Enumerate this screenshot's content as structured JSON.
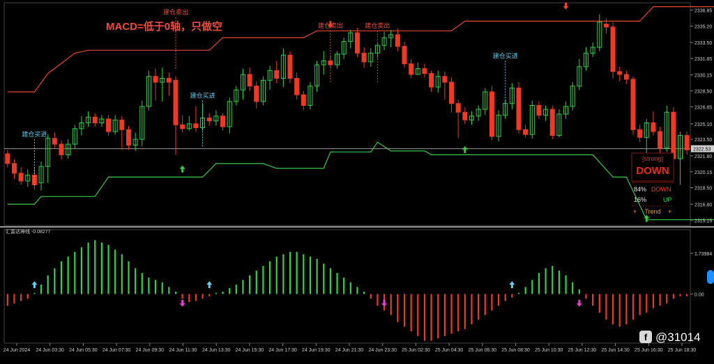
{
  "watermark": "@31014",
  "chart_data": [
    {
      "type": "candlestick",
      "annotation_macd": "MACD=低于0轴，只做空",
      "last_price": "2322.53",
      "y_ticks": [
        "2336.85",
        "2335.20",
        "2333.50",
        "2331.85",
        "2330.15",
        "2328.50",
        "2326.85",
        "2325.10",
        "2323.50",
        "2321.80",
        "2320.15",
        "2318.50",
        "2316.80",
        "2315.15"
      ],
      "ylim": [
        2314.6,
        2337.6
      ],
      "candles": [
        [
          2322.0,
          2321.0,
          2322.4,
          2320.6
        ],
        [
          2321.0,
          2320.0,
          2321.4,
          2319.4
        ],
        [
          2320.0,
          2319.2,
          2320.6,
          2318.8
        ],
        [
          2319.2,
          2319.8,
          2320.4,
          2318.6
        ],
        [
          2319.8,
          2318.8,
          2320.6,
          2318.3
        ],
        [
          2319.0,
          2320.7,
          2321.2,
          2318.2
        ],
        [
          2320.7,
          2323.6,
          2324.0,
          2319.0
        ],
        [
          2323.6,
          2323.0,
          2324.2,
          2322.6
        ],
        [
          2323.0,
          2321.9,
          2323.4,
          2321.4
        ],
        [
          2321.9,
          2323.0,
          2323.5,
          2321.5
        ],
        [
          2323.0,
          2324.6,
          2325.0,
          2322.5
        ],
        [
          2324.6,
          2325.2,
          2325.9,
          2323.9
        ],
        [
          2325.2,
          2325.8,
          2326.4,
          2324.8
        ],
        [
          2325.8,
          2325.2,
          2326.2,
          2324.8
        ],
        [
          2325.2,
          2325.6,
          2326.0,
          2324.8
        ],
        [
          2325.6,
          2324.3,
          2326.0,
          2323.9
        ],
        [
          2324.3,
          2325.5,
          2326.0,
          2324.0
        ],
        [
          2325.5,
          2324.5,
          2325.9,
          2322.4
        ],
        [
          2324.5,
          2322.9,
          2324.9,
          2322.4
        ],
        [
          2322.9,
          2323.5,
          2324.2,
          2322.3
        ],
        [
          2323.5,
          2326.9,
          2327.5,
          2322.8
        ],
        [
          2326.9,
          2330.0,
          2330.6,
          2326.5
        ],
        [
          2330.0,
          2329.4,
          2330.8,
          2327.5
        ],
        [
          2329.4,
          2329.8,
          2330.9,
          2327.4
        ],
        [
          2329.8,
          2329.4,
          2330.4,
          2328.0
        ],
        [
          2329.6,
          2325.0,
          2330.0,
          2321.9
        ],
        [
          2325.0,
          2324.6,
          2326.0,
          2324.2
        ],
        [
          2324.6,
          2325.1,
          2325.9,
          2324.4
        ],
        [
          2325.1,
          2324.7,
          2326.9,
          2324.3
        ],
        [
          2324.7,
          2325.7,
          2327.2,
          2324.4
        ],
        [
          2325.7,
          2325.4,
          2326.2,
          2324.9
        ],
        [
          2325.4,
          2325.9,
          2326.5,
          2324.9
        ],
        [
          2325.9,
          2324.8,
          2326.2,
          2324.4
        ],
        [
          2324.8,
          2327.4,
          2327.8,
          2324.1
        ],
        [
          2327.4,
          2328.6,
          2329.0,
          2327.0
        ],
        [
          2328.6,
          2330.2,
          2330.8,
          2327.6
        ],
        [
          2330.2,
          2329.0,
          2330.9,
          2328.5
        ],
        [
          2329.0,
          2327.4,
          2329.5,
          2326.7
        ],
        [
          2327.4,
          2329.6,
          2330.0,
          2327.0
        ],
        [
          2329.6,
          2330.6,
          2331.1,
          2328.6
        ],
        [
          2330.6,
          2329.8,
          2331.6,
          2329.3
        ],
        [
          2329.8,
          2332.2,
          2332.9,
          2328.9
        ],
        [
          2332.2,
          2329.8,
          2332.6,
          2329.3
        ],
        [
          2329.8,
          2328.1,
          2330.4,
          2327.6
        ],
        [
          2328.1,
          2327.0,
          2328.5,
          2326.5
        ],
        [
          2327.0,
          2329.0,
          2329.4,
          2326.6
        ],
        [
          2329.0,
          2331.2,
          2331.6,
          2328.4
        ],
        [
          2331.2,
          2331.6,
          2332.6,
          2330.2
        ],
        [
          2331.6,
          2331.2,
          2332.2,
          2330.8
        ],
        [
          2331.2,
          2332.3,
          2332.6,
          2330.8
        ],
        [
          2332.3,
          2333.6,
          2334.0,
          2331.8
        ],
        [
          2333.6,
          2334.5,
          2334.8,
          2332.9
        ],
        [
          2334.5,
          2332.4,
          2335.0,
          2332.0
        ],
        [
          2332.4,
          2331.5,
          2333.0,
          2330.9
        ],
        [
          2331.5,
          2332.4,
          2332.9,
          2331.0
        ],
        [
          2332.4,
          2333.2,
          2333.5,
          2331.9
        ],
        [
          2333.2,
          2334.0,
          2334.6,
          2332.7
        ],
        [
          2334.0,
          2334.3,
          2334.8,
          2333.0
        ],
        [
          2334.3,
          2333.1,
          2334.9,
          2332.6
        ],
        [
          2333.1,
          2331.3,
          2333.6,
          2330.9
        ],
        [
          2331.3,
          2330.2,
          2331.8,
          2329.8
        ],
        [
          2330.2,
          2330.8,
          2331.4,
          2330.2
        ],
        [
          2330.8,
          2330.3,
          2331.3,
          2329.9
        ],
        [
          2330.3,
          2328.9,
          2330.6,
          2328.4
        ],
        [
          2328.9,
          2330.0,
          2330.6,
          2328.3
        ],
        [
          2330.0,
          2329.4,
          2330.5,
          2327.6
        ],
        [
          2329.4,
          2327.2,
          2329.9,
          2326.3
        ],
        [
          2327.2,
          2326.3,
          2327.6,
          2323.6
        ],
        [
          2326.3,
          2325.5,
          2326.8,
          2325.1
        ],
        [
          2325.5,
          2325.9,
          2326.4,
          2325.0
        ],
        [
          2325.9,
          2326.6,
          2327.0,
          2325.4
        ],
        [
          2326.6,
          2328.4,
          2328.8,
          2326.0
        ],
        [
          2328.4,
          2323.8,
          2329.0,
          2323.4
        ],
        [
          2323.8,
          2326.0,
          2326.5,
          2323.3
        ],
        [
          2326.0,
          2327.2,
          2327.6,
          2325.6
        ],
        [
          2327.2,
          2328.8,
          2329.3,
          2326.6
        ],
        [
          2328.8,
          2324.5,
          2329.4,
          2324.1
        ],
        [
          2324.5,
          2324.0,
          2325.0,
          2323.7
        ],
        [
          2324.0,
          2327.0,
          2327.5,
          2323.6
        ],
        [
          2327.0,
          2326.0,
          2327.4,
          2325.6
        ],
        [
          2326.0,
          2326.6,
          2327.0,
          2325.4
        ],
        [
          2326.6,
          2323.9,
          2327.0,
          2323.5
        ],
        [
          2323.9,
          2326.1,
          2326.6,
          2323.7
        ],
        [
          2326.1,
          2326.9,
          2327.4,
          2325.6
        ],
        [
          2326.9,
          2329.0,
          2329.4,
          2326.5
        ],
        [
          2329.0,
          2331.0,
          2331.8,
          2328.6
        ],
        [
          2331.0,
          2332.4,
          2333.0,
          2330.6
        ],
        [
          2332.4,
          2333.0,
          2333.5,
          2332.0
        ],
        [
          2333.0,
          2335.6,
          2336.4,
          2332.6
        ],
        [
          2335.4,
          2335.1,
          2336.0,
          2334.4
        ],
        [
          2335.1,
          2330.5,
          2335.6,
          2329.8
        ],
        [
          2330.5,
          2330.2,
          2331.0,
          2329.5
        ],
        [
          2330.2,
          2329.7,
          2330.6,
          2329.2
        ],
        [
          2329.7,
          2324.5,
          2330.0,
          2324.0
        ],
        [
          2324.5,
          2323.7,
          2325.0,
          2323.2
        ],
        [
          2323.7,
          2325.2,
          2325.6,
          2321.7
        ],
        [
          2325.2,
          2324.3,
          2326.4,
          2323.9
        ],
        [
          2324.3,
          2322.6,
          2324.8,
          2321.7
        ],
        [
          2322.6,
          2326.3,
          2327.0,
          2322.2
        ],
        [
          2326.3,
          2321.5,
          2326.8,
          2321.0
        ],
        [
          2321.5,
          2323.9,
          2324.3,
          2318.8
        ],
        [
          2323.9,
          2322.4,
          2324.3,
          2321.9
        ]
      ],
      "upper_line": [
        [
          0,
          2328.4
        ],
        [
          4,
          2328.4
        ],
        [
          6,
          2330.3
        ],
        [
          10,
          2332.4
        ],
        [
          12,
          2332.7
        ],
        [
          30,
          2332.7
        ],
        [
          32,
          2334.0
        ],
        [
          44,
          2334.0
        ],
        [
          46,
          2334.7
        ],
        [
          66,
          2334.7
        ],
        [
          68,
          2335.7
        ],
        [
          94,
          2335.7
        ],
        [
          96,
          2337.2
        ],
        [
          106,
          2337.2
        ]
      ],
      "lower_line": [
        [
          0,
          2316.8
        ],
        [
          4,
          2316.8
        ],
        [
          5,
          2317.6
        ],
        [
          13,
          2317.6
        ],
        [
          15,
          2319.6
        ],
        [
          29,
          2319.6
        ],
        [
          31,
          2321.0
        ],
        [
          38,
          2321.0
        ],
        [
          40,
          2320.5
        ],
        [
          47,
          2320.5
        ],
        [
          48,
          2322.2
        ],
        [
          54,
          2322.2
        ],
        [
          55,
          2323.2
        ],
        [
          57,
          2322.3
        ],
        [
          62,
          2322.3
        ],
        [
          63,
          2321.9
        ],
        [
          87,
          2321.9
        ],
        [
          90,
          2319.6
        ],
        [
          92,
          2319.6
        ],
        [
          95,
          2315.2
        ],
        [
          106,
          2315.2
        ]
      ],
      "labels": [
        {
          "text": "建仓买进",
          "i": 4,
          "price": 2323.8,
          "color": "#5fd0ef"
        },
        {
          "text": "建仓卖出",
          "i": 25,
          "price": 2336.4,
          "color": "#ef4b39"
        },
        {
          "text": "建仓买进",
          "i": 29,
          "price": 2327.8,
          "color": "#5fd0ef"
        },
        {
          "text": "建仓卖出",
          "i": 48,
          "price": 2335.0,
          "color": "#ef4b39"
        },
        {
          "text": "建仓卖出",
          "i": 55,
          "price": 2335.0,
          "color": "#ef4b39"
        },
        {
          "text": "建仓买进",
          "i": 74,
          "price": 2331.9,
          "color": "#5fd0ef"
        }
      ],
      "up_arrows": [
        [
          26,
          2320.3
        ],
        [
          68,
          2322.3
        ],
        [
          95,
          2315.2
        ]
      ],
      "down_arrows": [
        [
          48,
          2335.5
        ],
        [
          83,
          2337.4
        ]
      ],
      "signal_box": {
        "strong": "[strong]",
        "direction": "DOWN",
        "down_pct": "84%",
        "down_label": "DOWN",
        "up_pct": "16%",
        "up_label": "UP",
        "trend_label": "Trend"
      }
    },
    {
      "type": "bar",
      "title": "汇富达神线 -0.08277",
      "y_ticks": [
        "1.73984",
        "0.00"
      ],
      "ylim": [
        -2.1,
        2.75
      ],
      "values": [
        -0.5,
        -0.4,
        -0.3,
        -0.2,
        0.05,
        0.4,
        0.8,
        1.1,
        1.4,
        1.6,
        1.8,
        2.0,
        2.2,
        2.3,
        2.2,
        2.1,
        1.9,
        1.7,
        1.4,
        1.1,
        0.9,
        0.7,
        0.6,
        0.5,
        0.3,
        0.1,
        -0.2,
        -0.35,
        -0.3,
        -0.2,
        -0.1,
        0.05,
        0.1,
        0.25,
        0.4,
        0.6,
        0.8,
        1.0,
        1.2,
        1.4,
        1.6,
        1.7,
        1.8,
        1.8,
        1.7,
        1.6,
        1.5,
        1.3,
        1.1,
        0.9,
        0.7,
        0.5,
        0.3,
        0.1,
        -0.2,
        -0.5,
        -0.7,
        -0.9,
        -1.2,
        -1.4,
        -1.6,
        -1.8,
        -2.0,
        -2.0,
        -1.9,
        -1.8,
        -1.7,
        -1.6,
        -1.5,
        -1.3,
        -1.1,
        -0.9,
        -0.7,
        -0.5,
        -0.3,
        -0.15,
        0.05,
        0.3,
        0.6,
        0.9,
        1.1,
        1.2,
        1.0,
        0.8,
        0.5,
        0.2,
        -0.2,
        -0.5,
        -0.8,
        -1.1,
        -1.3,
        -1.4,
        -1.3,
        -1.1,
        -0.9,
        -0.8,
        -0.6,
        -0.5,
        -0.4,
        -0.2,
        -0.1,
        -0.1
      ],
      "up_arrows": [
        [
          4,
          0.1
        ],
        [
          30,
          0.1
        ],
        [
          75,
          0.1
        ]
      ],
      "down_arrows": [
        [
          26,
          -0.1
        ],
        [
          56,
          -0.1
        ],
        [
          85,
          -0.1
        ]
      ]
    }
  ],
  "x_ticks": [
    "24 Jun 2024",
    "24 Jun 03:30",
    "24 Jun 05:30",
    "24 Jun 07:30",
    "24 Jun 09:30",
    "24 Jun 11:30",
    "24 Jun 13:30",
    "24 Jun 15:30",
    "24 Jun 17:30",
    "24 Jun 19:30",
    "24 Jun 21:30",
    "24 Jun 23:30",
    "25 Jun 02:30",
    "25 Jun 04:30",
    "25 Jun 06:30",
    "25 Jun 08:30",
    "25 Jun 10:30",
    "25 Jun 12:30",
    "25 Jun 14:30",
    "25 Jun 16:30",
    "25 Jun 18:30"
  ],
  "colors": {
    "bull": "#2fd248",
    "bear": "#ee3a24",
    "upper": "#e8462f",
    "lower": "#39c94a",
    "cyan": "#5fd0ef",
    "magenta": "#ef3bd8",
    "grid": "#3a3a3a",
    "axis_text": "#cfcfcf"
  }
}
